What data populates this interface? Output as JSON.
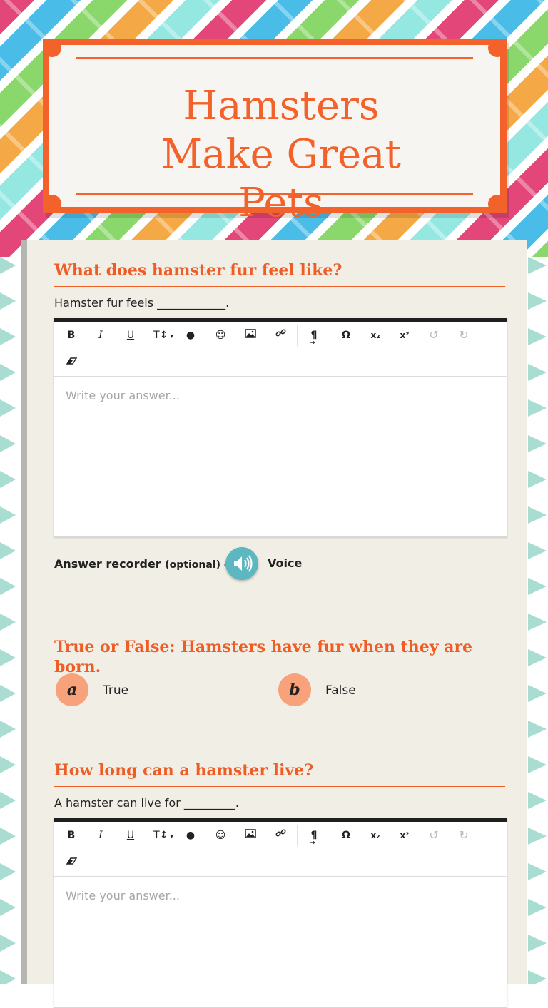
{
  "page": {
    "title": "Hamsters Make Great Pets"
  },
  "questions": [
    {
      "title": "What does hamster fur feel like?",
      "prompt": "Hamster fur feels ____________.",
      "editor": {
        "toolbar": [
          "B",
          "I",
          "U",
          "T↕",
          "💧",
          "☺",
          "image",
          "link",
          "¶",
          "Ω",
          "x₂",
          "x²",
          "↺",
          "↻",
          "eraser"
        ],
        "placeholder": "Write your answer..."
      },
      "recorder": {
        "label": "Answer recorder",
        "optional": "(optional) -",
        "voice": "Voice"
      }
    },
    {
      "title": "True or False: Hamsters have fur when they are born.",
      "options": [
        {
          "letter": "a",
          "label": "True"
        },
        {
          "letter": "b",
          "label": "False"
        }
      ]
    },
    {
      "title": "How long can a hamster live?",
      "prompt": "A hamster can live for _________.",
      "editor": {
        "placeholder": "Write your answer..."
      }
    }
  ],
  "toolbar_labels": {
    "bold": "B",
    "italic": "I",
    "underline": "U",
    "size": "T↕",
    "color": "●",
    "emoji": "☺",
    "image": "▣",
    "link": "∞",
    "para": "¶",
    "omega": "Ω",
    "sub": "x₂",
    "sup": "x²",
    "undo": "↺",
    "redo": "↻",
    "clear": "▱"
  },
  "colors": {
    "accent": "#f2622a",
    "option_circle": "#f7a27a",
    "speaker": "#5cb7c0"
  }
}
